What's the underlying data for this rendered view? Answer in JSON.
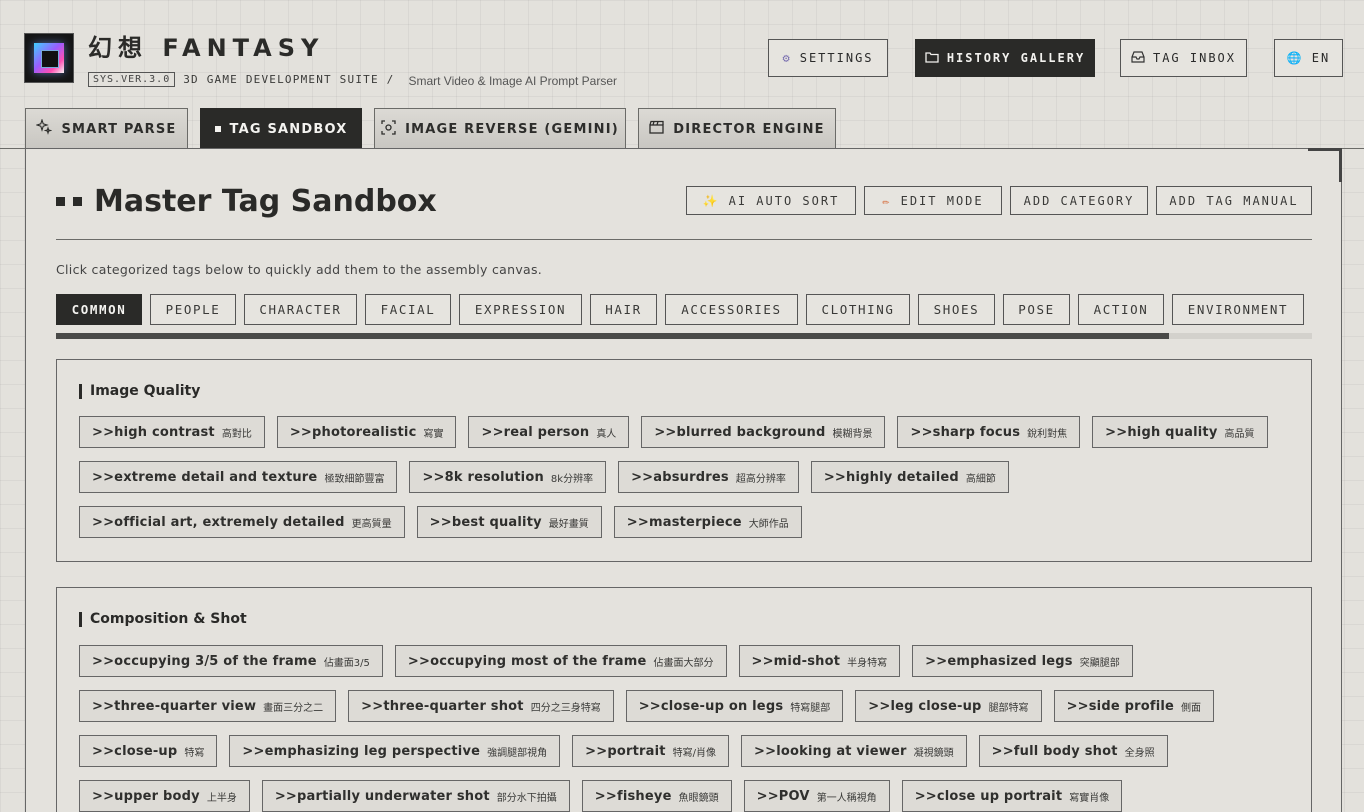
{
  "brand": {
    "title": "幻想 FANTASY",
    "version": "SYS.VER.3.0",
    "suite": "3D GAME DEVELOPMENT SUITE /",
    "tagline": "Smart Video & Image AI Prompt Parser"
  },
  "header_buttons": {
    "settings": "SETTINGS",
    "history": "HISTORY GALLERY",
    "inbox": "TAG INBOX",
    "lang": "EN"
  },
  "tabs": {
    "smart_parse": "SMART PARSE",
    "tag_sandbox": "TAG SANDBOX",
    "image_reverse": "IMAGE REVERSE (GEMINI)",
    "director": "DIRECTOR ENGINE"
  },
  "main": {
    "title": "Master Tag Sandbox",
    "actions": {
      "ai_sort": "AI AUTO SORT",
      "edit": "EDIT MODE",
      "add_category": "ADD CATEGORY",
      "add_tag": "ADD TAG MANUAL"
    },
    "hint": "Click categorized tags below to quickly add them to the assembly canvas.",
    "categories": [
      "COMMON",
      "PEOPLE",
      "CHARACTER",
      "FACIAL",
      "EXPRESSION",
      "HAIR",
      "ACCESSORIES",
      "CLOTHING",
      "SHOES",
      "POSE",
      "ACTION",
      "ENVIRONMENT"
    ],
    "active_category": "COMMON"
  },
  "sections": [
    {
      "title": "Image Quality",
      "rows": [
        [
          {
            "en": ">>high contrast",
            "zh": "高對比"
          },
          {
            "en": ">>photorealistic",
            "zh": "寫實"
          },
          {
            "en": ">>real person",
            "zh": "真人"
          },
          {
            "en": ">>blurred background",
            "zh": "模糊背景"
          },
          {
            "en": ">>sharp focus",
            "zh": "銳利對焦"
          },
          {
            "en": ">>high quality",
            "zh": "高品質"
          }
        ],
        [
          {
            "en": ">>extreme detail and texture",
            "zh": "極致細節豐富"
          },
          {
            "en": ">>8k resolution",
            "zh": "8k分辨率"
          },
          {
            "en": ">>absurdres",
            "zh": "超高分辨率"
          },
          {
            "en": ">>highly detailed",
            "zh": "高細節"
          }
        ],
        [
          {
            "en": ">>official art, extremely detailed",
            "zh": "更高質量"
          },
          {
            "en": ">>best quality",
            "zh": "最好畫質"
          },
          {
            "en": ">>masterpiece",
            "zh": "大師作品"
          }
        ]
      ]
    },
    {
      "title": "Composition & Shot",
      "rows": [
        [
          {
            "en": ">>occupying 3/5 of the frame",
            "zh": "佔畫面3/5"
          },
          {
            "en": ">>occupying most of the frame",
            "zh": "佔畫面大部分"
          },
          {
            "en": ">>mid-shot",
            "zh": "半身特寫"
          },
          {
            "en": ">>emphasized legs",
            "zh": "突顯腿部"
          }
        ],
        [
          {
            "en": ">>three-quarter view",
            "zh": "畫面三分之二"
          },
          {
            "en": ">>three-quarter shot",
            "zh": "四分之三身特寫"
          },
          {
            "en": ">>close-up on legs",
            "zh": "特寫腿部"
          },
          {
            "en": ">>leg close-up",
            "zh": "腿部特寫"
          },
          {
            "en": ">>side profile",
            "zh": "側面"
          }
        ],
        [
          {
            "en": ">>close-up",
            "zh": "特寫"
          },
          {
            "en": ">>emphasizing leg perspective",
            "zh": "強調腿部視角"
          },
          {
            "en": ">>portrait",
            "zh": "特寫/肖像"
          },
          {
            "en": ">>looking at viewer",
            "zh": "凝視鏡頭"
          },
          {
            "en": ">>full body shot",
            "zh": "全身照"
          }
        ],
        [
          {
            "en": ">>upper body",
            "zh": "上半身"
          },
          {
            "en": ">>partially underwater shot",
            "zh": "部分水下拍攝"
          },
          {
            "en": ">>fisheye",
            "zh": "魚眼鏡頭"
          },
          {
            "en": ">>POV",
            "zh": "第一人稱視角"
          },
          {
            "en": ">>close up portrait",
            "zh": "寫實肖像"
          }
        ]
      ]
    }
  ]
}
